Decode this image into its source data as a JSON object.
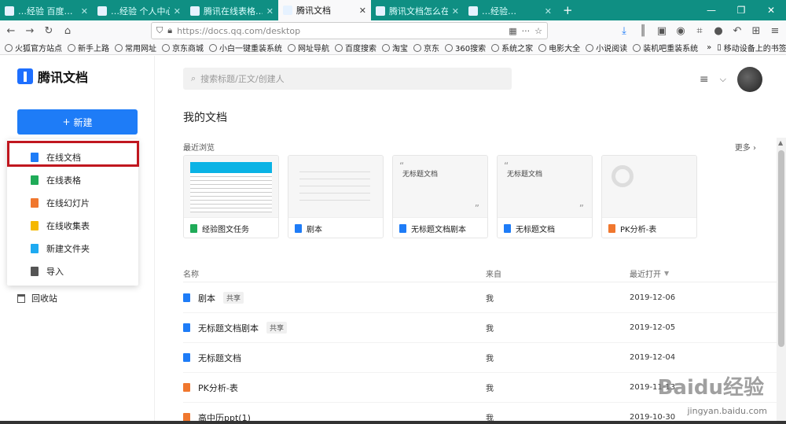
{
  "browser": {
    "tabs": [
      {
        "title": "…经验 百度…"
      },
      {
        "title": "…经验 个人中心"
      },
      {
        "title": "腾讯在线表格…"
      },
      {
        "title": "腾讯文档",
        "active": true
      },
      {
        "title": "腾讯文档怎么在…"
      },
      {
        "title": "…经验…"
      }
    ],
    "url": "https://docs.qq.com/desktop",
    "bookmarks": [
      "火狐官方站点",
      "新手上路",
      "常用网址",
      "京东商城",
      "小白一键重装系统",
      "网址导航",
      "百度搜索",
      "淘宝",
      "京东",
      "360搜索",
      "系统之家",
      "电影大全",
      "小说阅读",
      "装机吧重装系统"
    ],
    "bookmarks_right": "移动设备上的书签"
  },
  "sidebar": {
    "logo_text": "腾讯文档",
    "new_button": "新建",
    "new_icon": "+",
    "menu": [
      {
        "label": "在线文档",
        "color": "#1e7cf7"
      },
      {
        "label": "在线表格",
        "color": "#1fab58"
      },
      {
        "label": "在线幻灯片",
        "color": "#f0772e"
      },
      {
        "label": "在线收集表",
        "color": "#f5b800"
      },
      {
        "label": "新建文件夹",
        "color": "#1eaaf1"
      },
      {
        "label": "导入",
        "color": "#555555"
      }
    ],
    "recycle": "回收站"
  },
  "main": {
    "search_placeholder": "搜索标题/正文/创建人",
    "title": "我的文档",
    "recent_label": "最近浏览",
    "more": "更多",
    "cards": [
      {
        "name": "经验图文任务",
        "type": "sheet"
      },
      {
        "name": "剧本",
        "type": "doc"
      },
      {
        "name": "无标题文档剧本",
        "type": "doc",
        "preview": "无标题文档"
      },
      {
        "name": "无标题文档",
        "type": "doc",
        "preview": "无标题文档"
      },
      {
        "name": "PK分析-表",
        "type": "slide"
      }
    ],
    "columns": {
      "name": "名称",
      "from": "来自",
      "date": "最近打开"
    },
    "rows": [
      {
        "name": "剧本",
        "tag": "共享",
        "from": "我",
        "date": "2019-12-06",
        "type": "doc"
      },
      {
        "name": "无标题文档剧本",
        "tag": "共享",
        "from": "我",
        "date": "2019-12-05",
        "type": "doc"
      },
      {
        "name": "无标题文档",
        "tag": "",
        "from": "我",
        "date": "2019-12-04",
        "type": "doc"
      },
      {
        "name": "PK分析-表",
        "tag": "",
        "from": "我",
        "date": "2019-11-13",
        "type": "slide"
      },
      {
        "name": "高中历ppt(1)",
        "tag": "",
        "from": "我",
        "date": "2019-10-30",
        "type": "slide"
      }
    ]
  },
  "watermark": {
    "brand": "Baidu经验",
    "url": "jingyan.baidu.com"
  }
}
